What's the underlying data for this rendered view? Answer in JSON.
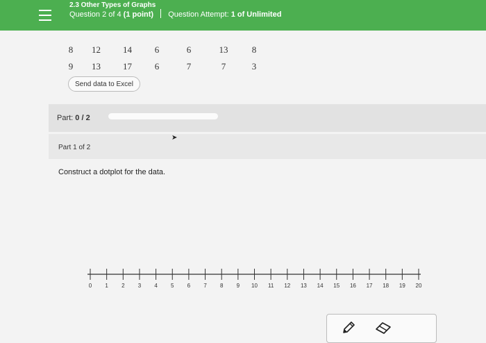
{
  "header": {
    "section_title": "2.3 Other Types of Graphs",
    "question_prefix": "Question 2 of 4",
    "points": "(1 point)",
    "attempt_prefix": "Question Attempt:",
    "attempt_value": "1 of Unlimited"
  },
  "data_table": {
    "rows": [
      [
        "8",
        "12",
        "14",
        "6",
        "6",
        "13",
        "8"
      ],
      [
        "9",
        "13",
        "17",
        "6",
        "7",
        "7",
        "3"
      ]
    ]
  },
  "excel_button": {
    "label": "Send data to Excel"
  },
  "part_progress": {
    "prefix": "Part:",
    "value": "0 / 2",
    "fraction_complete": 0
  },
  "part_header": {
    "label": "Part 1 of 2"
  },
  "instruction": "Construct a dotplot for the data.",
  "number_line": {
    "min": 0,
    "max": 20,
    "tick_labels": [
      "0",
      "1",
      "2",
      "3",
      "4",
      "5",
      "6",
      "7",
      "8",
      "9",
      "10",
      "11",
      "12",
      "13",
      "14",
      "15",
      "16",
      "17",
      "18",
      "19",
      "20"
    ]
  },
  "tools": [
    {
      "icon": "pencil-icon"
    },
    {
      "icon": "eraser-icon"
    }
  ],
  "colors": {
    "header_bg": "#4caf50",
    "part_bar_bg": "#e2e2e2"
  }
}
